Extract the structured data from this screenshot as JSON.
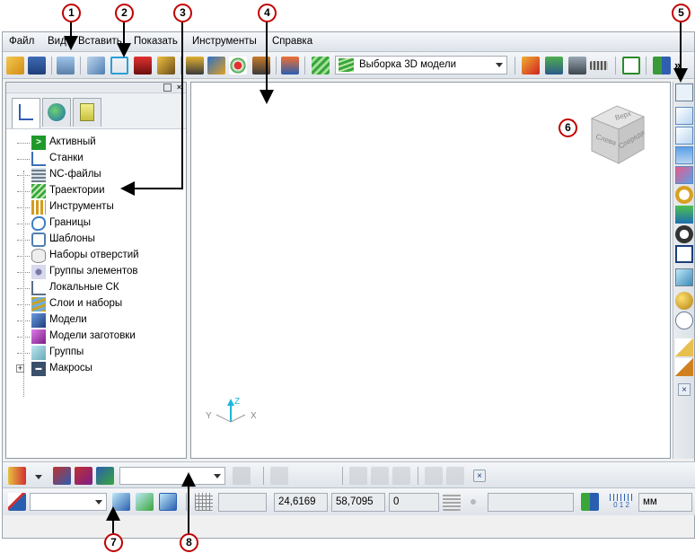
{
  "menu": [
    "Файл",
    "Вид",
    "Вставить",
    "Показать",
    "Инструменты",
    "Справка"
  ],
  "toolbar": {
    "model_combo_value": "Выборка 3D модели"
  },
  "explorer": {
    "items": [
      {
        "label": "Активный",
        "icon": "active-icon",
        "color": "#1f9a2a"
      },
      {
        "label": "Станки",
        "icon": "machine-icon",
        "color": "#3b6fb6"
      },
      {
        "label": "NC-файлы",
        "icon": "nc-files-icon",
        "color": "#6e7c8a"
      },
      {
        "label": "Траектории",
        "icon": "toolpaths-icon",
        "color": "#3aa63a"
      },
      {
        "label": "Инструменты",
        "icon": "tools-icon",
        "color": "#d49b1d"
      },
      {
        "label": "Границы",
        "icon": "boundaries-icon",
        "color": "#3d7fc4"
      },
      {
        "label": "Шаблоны",
        "icon": "patterns-icon",
        "color": "#4f7fb0"
      },
      {
        "label": "Наборы отверстий",
        "icon": "holes-icon",
        "color": "#8c8c8c"
      },
      {
        "label": "Группы элементов",
        "icon": "feature-groups-icon",
        "color": "#7a7aa8"
      },
      {
        "label": "Локальные СК",
        "icon": "workplanes-icon",
        "color": "#5a6f8a"
      },
      {
        "label": "Слои и наборы",
        "icon": "layers-icon",
        "color": "#c9a227"
      },
      {
        "label": "Модели",
        "icon": "models-icon",
        "color": "#2f5a9a"
      },
      {
        "label": "Модели заготовки",
        "icon": "stock-models-icon",
        "color": "#a23bb0"
      },
      {
        "label": "Группы",
        "icon": "groups-icon",
        "color": "#6aa8b8"
      },
      {
        "label": "Макросы",
        "icon": "macros-icon",
        "color": "#3a4f6a",
        "expandable": true
      }
    ]
  },
  "viewcube": {
    "top": "Верх",
    "left": "Слева",
    "front": "Спереди"
  },
  "triad": {
    "x": "X",
    "y": "Y",
    "z": "Z"
  },
  "status": {
    "x_coord": "24,6169",
    "y_coord": "58,7095",
    "z_coord": "0",
    "units": "мм",
    "scale_label": "0 1 2"
  },
  "callouts": [
    "1",
    "2",
    "3",
    "4",
    "5",
    "6",
    "7",
    "8"
  ]
}
